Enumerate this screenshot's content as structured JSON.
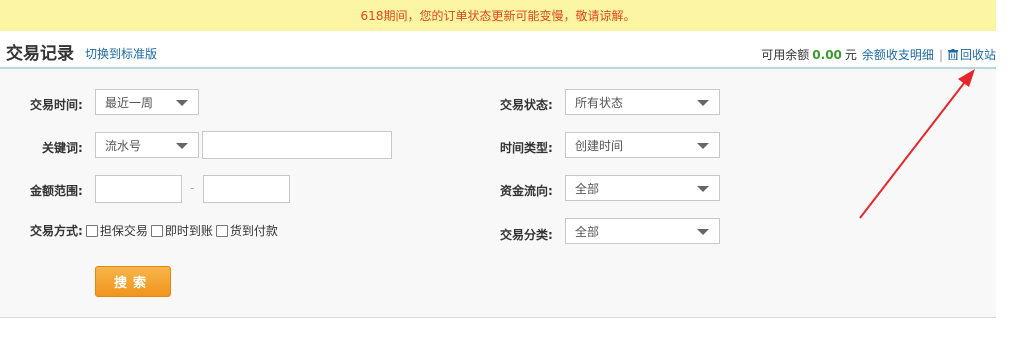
{
  "notice": {
    "text": "618期间，您的订单状态更新可能变慢，敬请谅解。"
  },
  "header": {
    "title": "交易记录",
    "switch_link": "切换到标准版",
    "balance_label": "可用余额",
    "balance_amount": "0.00",
    "balance_unit": "元",
    "balance_detail_link": "余额收支明细",
    "separator": "|",
    "recycle_link": "回收站"
  },
  "form": {
    "trade_time": {
      "label": "交易时间:",
      "value": "最近一周"
    },
    "keyword": {
      "label": "关键词:",
      "select_value": "流水号",
      "input_value": ""
    },
    "amount_range": {
      "label": "金额范围:",
      "min_value": "",
      "max_value": "",
      "separator": "-"
    },
    "trade_method": {
      "label": "交易方式:",
      "options": [
        "担保交易",
        "即时到账",
        "货到付款"
      ]
    },
    "trade_status": {
      "label": "交易状态:",
      "value": "所有状态"
    },
    "time_type": {
      "label": "时间类型:",
      "value": "创建时间"
    },
    "fund_flow": {
      "label": "资金流向:",
      "value": "全部"
    },
    "trade_category": {
      "label": "交易分类:",
      "value": "全部"
    },
    "search_button": "搜索"
  },
  "colors": {
    "notice_bg": "#fcf6a4",
    "notice_text": "#e0471a",
    "link": "#1b6aa5",
    "amount": "#3a9a2d",
    "button": "#f0951c",
    "arrow": "#e8262a"
  },
  "icons": {
    "recycle": "trash-icon",
    "dropdown": "chevron-down-icon"
  }
}
